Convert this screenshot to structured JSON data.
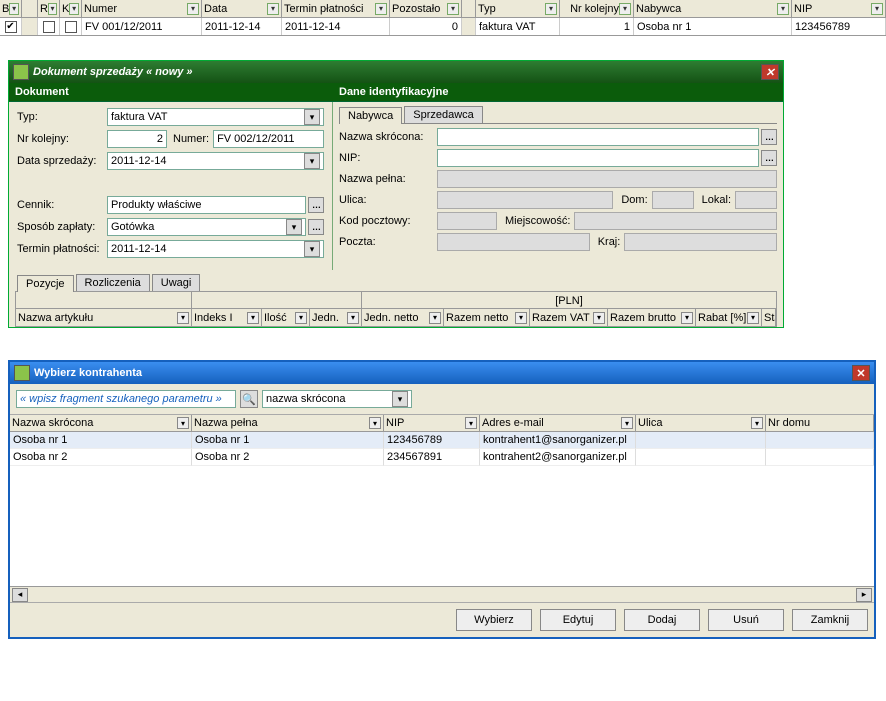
{
  "bg_grid": {
    "headers": [
      "B",
      "",
      "R",
      "K",
      "Numer",
      "Data",
      "Termin płatności",
      "Pozostało",
      "",
      "Typ",
      "Nr kolejny",
      "Nabywca",
      "NIP"
    ],
    "row": {
      "b_checked": true,
      "r_checked": false,
      "k_checked": false,
      "numer": "FV 001/12/2011",
      "data": "2011-12-14",
      "termin": "2011-12-14",
      "pozostalo": "0",
      "typ": "faktura VAT",
      "nr_kolejny": "1",
      "nabywca": "Osoba nr 1",
      "nip": "123456789"
    }
  },
  "doc": {
    "title": "Dokument sprzedaży   « nowy »",
    "section_dokument": "Dokument",
    "section_dane": "Dane identyfikacyjne",
    "typ_lbl": "Typ:",
    "typ_val": "faktura VAT",
    "nrk_lbl": "Nr kolejny:",
    "nrk_val": "2",
    "numer_lbl": "Numer:",
    "numer_val": "FV 002/12/2011",
    "data_spr_lbl": "Data sprzedaży:",
    "data_spr_val": "2011-12-14",
    "cennik_lbl": "Cennik:",
    "cennik_val": "Produkty właściwe",
    "sposob_lbl": "Sposób zapłaty:",
    "sposob_val": "Gotówka",
    "terminp_lbl": "Termin płatności:",
    "terminp_val": "2011-12-14",
    "tab_nabywca": "Nabywca",
    "tab_sprzedawca": "Sprzedawca",
    "nazwa_skr_lbl": "Nazwa skrócona:",
    "nip_lbl": "NIP:",
    "nazwa_pelna_lbl": "Nazwa pełna:",
    "ulica_lbl": "Ulica:",
    "dom_lbl": "Dom:",
    "lokal_lbl": "Lokal:",
    "kod_lbl": "Kod pocztowy:",
    "miejsc_lbl": "Miejscowość:",
    "poczta_lbl": "Poczta:",
    "kraj_lbl": "Kraj:",
    "sub_tabs": [
      "Pozycje",
      "Rozliczenia",
      "Uwagi"
    ],
    "pln": "[PLN]",
    "item_cols": [
      "Nazwa artykułu",
      "Indeks I",
      "Ilość",
      "Jedn.",
      "Jedn. netto",
      "Razem netto",
      "Razem VAT",
      "Razem brutto",
      "Rabat [%]",
      "Stawka VA"
    ]
  },
  "pick": {
    "title": "Wybierz kontrahenta",
    "search_placeholder": "« wpisz fragment szukanego parametru »",
    "search_field": "nazwa skrócona",
    "headers": [
      "Nazwa skrócona",
      "Nazwa pełna",
      "NIP",
      "Adres e-mail",
      "Ulica",
      "Nr domu"
    ],
    "rows": [
      {
        "skrocona": "Osoba nr 1",
        "pelna": "Osoba nr 1",
        "nip": "123456789",
        "email": "kontrahent1@sanorganizer.pl",
        "ulica": "",
        "nrdomu": ""
      },
      {
        "skrocona": "Osoba nr 2",
        "pelna": "Osoba nr 2",
        "nip": "234567891",
        "email": "kontrahent2@sanorganizer.pl",
        "ulica": "",
        "nrdomu": ""
      }
    ],
    "buttons": {
      "wybierz": "Wybierz",
      "edytuj": "Edytuj",
      "dodaj": "Dodaj",
      "usun": "Usuń",
      "zamknij": "Zamknij"
    }
  }
}
